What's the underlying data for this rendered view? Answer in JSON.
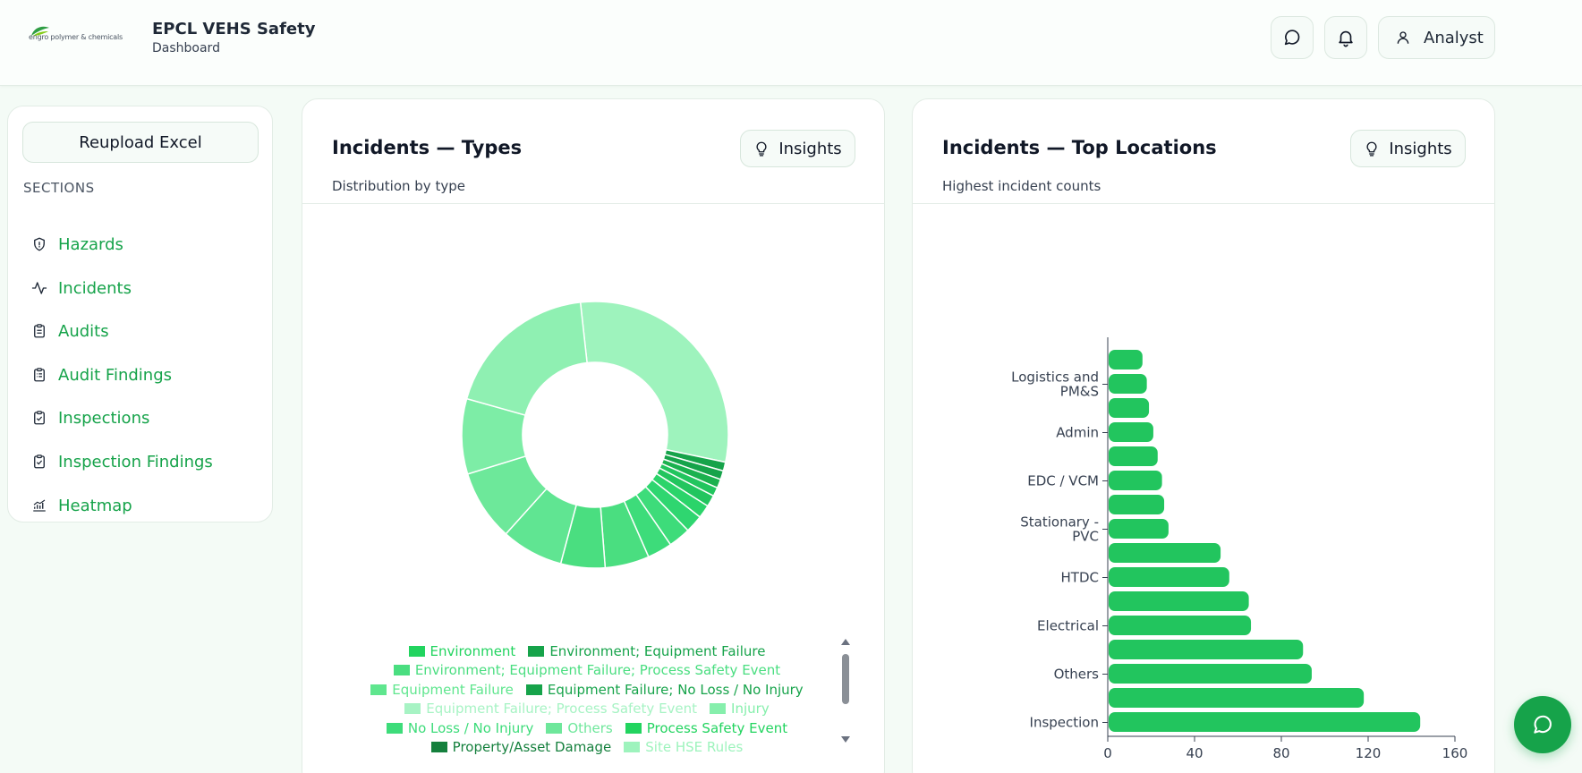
{
  "header": {
    "logo_text": "engro polymer & chemicals",
    "title": "EPCL VEHS Safety",
    "subtitle": "Dashboard",
    "chat_icon": "chat-bubble-icon",
    "bell_icon": "bell-icon",
    "user_label": "Analyst"
  },
  "sidebar": {
    "reupload_label": "Reupload Excel",
    "sections_label": "SECTIONS",
    "items": [
      {
        "label": "Hazards",
        "icon": "shield-icon"
      },
      {
        "label": "Incidents",
        "icon": "activity-icon"
      },
      {
        "label": "Audits",
        "icon": "clipboard-icon"
      },
      {
        "label": "Audit Findings",
        "icon": "clipboard-list-icon"
      },
      {
        "label": "Inspections",
        "icon": "clipboard-check-icon"
      },
      {
        "label": "Inspection Findings",
        "icon": "clipboard-check-icon"
      },
      {
        "label": "Heatmap",
        "icon": "chart-icon"
      }
    ]
  },
  "types_card": {
    "title": "Incidents — Types",
    "subtitle": "Distribution by type",
    "insights_label": "Insights"
  },
  "locations_card": {
    "title": "Incidents — Top Locations",
    "subtitle": "Highest incident counts",
    "insights_label": "Insights"
  },
  "colors": {
    "accent": "#16a34a",
    "bar": "#22c55e"
  },
  "chart_data": [
    {
      "type": "pie",
      "variant": "donut",
      "legend_position": "bottom",
      "slices": [
        {
          "value": 28.0,
          "color": "#9ef3bd"
        },
        {
          "value": 1.0,
          "color": "#16a34a"
        },
        {
          "value": 1.0,
          "color": "#16a34a"
        },
        {
          "value": 1.0,
          "color": "#1bb14e"
        },
        {
          "value": 1.0,
          "color": "#22c55e"
        },
        {
          "value": 1.3,
          "color": "#22c55e"
        },
        {
          "value": 1.5,
          "color": "#2bd46a"
        },
        {
          "value": 2.0,
          "color": "#2fd670"
        },
        {
          "value": 2.5,
          "color": "#3ddc7a"
        },
        {
          "value": 2.8,
          "color": "#3ddc7a"
        },
        {
          "value": 5.0,
          "color": "#4ade80"
        },
        {
          "value": 5.0,
          "color": "#4ade80"
        },
        {
          "value": 7.0,
          "color": "#60e592"
        },
        {
          "value": 8.0,
          "color": "#6de89a"
        },
        {
          "value": 8.5,
          "color": "#7deda6"
        },
        {
          "value": 17.6,
          "color": "#8ff0b2"
        }
      ],
      "legend": [
        {
          "label": "Environment",
          "color": "#22d45f"
        },
        {
          "label": "Environment; Equipment Failure",
          "color": "#16a34a"
        },
        {
          "label": "Environment; Equipment Failure; Process Safety Event",
          "color": "#4ade80"
        },
        {
          "label": "Equipment Failure",
          "color": "#5fe68e"
        },
        {
          "label": "Equipment Failure; No Loss / No Injury",
          "color": "#16a34a"
        },
        {
          "label": "Equipment Failure; Process Safety Event",
          "color": "#a7f3c4"
        },
        {
          "label": "Injury",
          "color": "#86efac"
        },
        {
          "label": "No Loss / No Injury",
          "color": "#3ddc7a"
        },
        {
          "label": "Others",
          "color": "#6ee79b"
        },
        {
          "label": "Process Safety Event",
          "color": "#22d45f"
        },
        {
          "label": "Property/Asset Damage",
          "color": "#15803d"
        },
        {
          "label": "Site HSE Rules",
          "color": "#9ef3bd"
        }
      ]
    },
    {
      "type": "bar",
      "orientation": "horizontal",
      "categories": [
        "",
        "Logistics and PM&S",
        "",
        "Admin",
        "",
        "EDC / VCM",
        "",
        "Stationary - PVC",
        "",
        "HTDC",
        "",
        "Electrical",
        "",
        "Others",
        "",
        "Inspection"
      ],
      "values": [
        16,
        18,
        19,
        21,
        23,
        25,
        26,
        28,
        52,
        56,
        65,
        66,
        90,
        94,
        118,
        144
      ],
      "xlim": [
        0,
        160
      ],
      "xticks": [
        "0",
        "40",
        "80",
        "120",
        "160"
      ]
    }
  ]
}
